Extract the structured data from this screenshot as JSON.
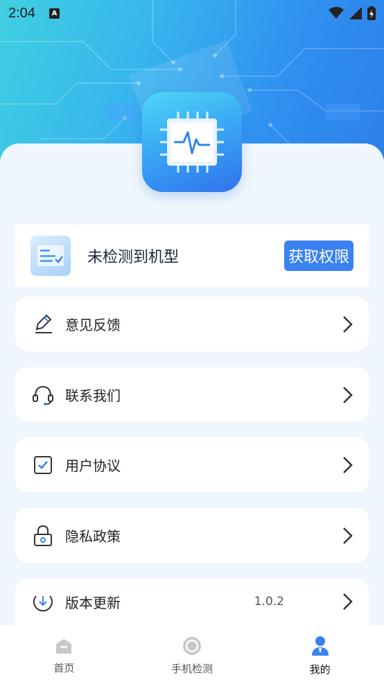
{
  "status_bar": {
    "time": "2:04",
    "notification_badge": "A"
  },
  "device_card": {
    "text": "未检测到机型",
    "button_label": "获取权限"
  },
  "menu": [
    {
      "label": "意见反馈",
      "icon": "pencil-icon"
    },
    {
      "label": "联系我们",
      "icon": "headset-icon"
    },
    {
      "label": "用户协议",
      "icon": "checkbox-icon"
    },
    {
      "label": "隐私政策",
      "icon": "lock-icon"
    },
    {
      "label": "版本更新",
      "icon": "download-icon",
      "value": "1.0.2"
    }
  ],
  "tabs": [
    {
      "label": "首页",
      "icon": "home-icon",
      "active": false
    },
    {
      "label": "手机检测",
      "icon": "gauge-icon",
      "active": false
    },
    {
      "label": "我的",
      "icon": "user-icon",
      "active": true
    }
  ],
  "colors": {
    "accent": "#3b82f0",
    "hero_start": "#3fd0e0",
    "hero_end": "#2d7fe8",
    "panel_bg": "#f0f6fd"
  }
}
